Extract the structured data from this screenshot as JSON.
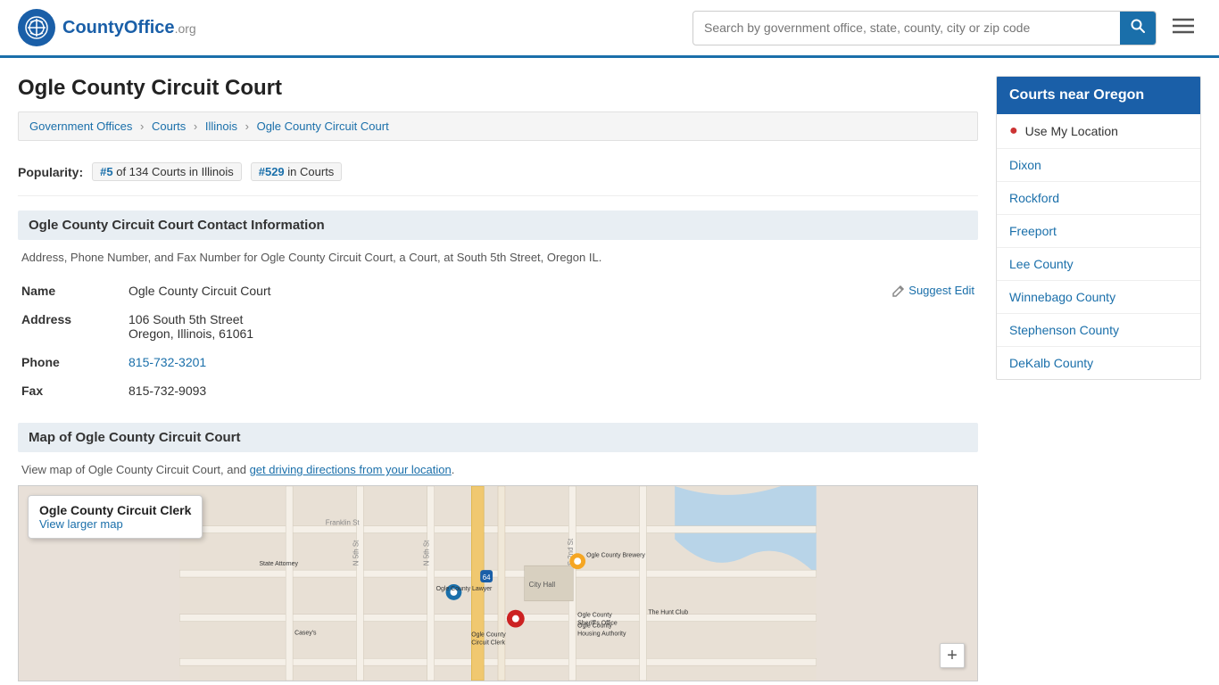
{
  "header": {
    "logo_text": "CountyOffice",
    "logo_org": ".org",
    "search_placeholder": "Search by government office, state, county, city or zip code",
    "search_value": ""
  },
  "page": {
    "title": "Ogle County Circuit Court",
    "breadcrumb": [
      {
        "label": "Government Offices",
        "href": "#"
      },
      {
        "label": "Courts",
        "href": "#"
      },
      {
        "label": "Illinois",
        "href": "#"
      },
      {
        "label": "Ogle County Circuit Court",
        "href": "#"
      }
    ],
    "popularity": {
      "label": "Popularity:",
      "rank1": "#5",
      "rank1_desc": "of 134 Courts in Illinois",
      "rank2": "#529",
      "rank2_desc": "in Courts"
    },
    "contact_section": {
      "title": "Ogle County Circuit Court Contact Information",
      "description": "Address, Phone Number, and Fax Number for Ogle County Circuit Court, a Court, at South 5th Street, Oregon IL.",
      "fields": [
        {
          "label": "Name",
          "value": "Ogle County Circuit Court",
          "type": "text"
        },
        {
          "label": "Address",
          "value": "106 South 5th Street",
          "value2": "Oregon, Illinois, 61061",
          "type": "address"
        },
        {
          "label": "Phone",
          "value": "815-732-3201",
          "type": "phone"
        },
        {
          "label": "Fax",
          "value": "815-732-9093",
          "type": "text"
        }
      ],
      "suggest_edit": "Suggest Edit"
    },
    "map_section": {
      "title": "Map of Ogle County Circuit Court",
      "description": "View map of Ogle County Circuit Court, and",
      "directions_link": "get driving directions from your location",
      "tooltip_title": "Ogle County Circuit Clerk",
      "tooltip_link": "View larger map"
    }
  },
  "sidebar": {
    "title": "Courts near Oregon",
    "use_location": "Use My Location",
    "items": [
      {
        "label": "Dixon"
      },
      {
        "label": "Rockford"
      },
      {
        "label": "Freeport"
      },
      {
        "label": "Lee County"
      },
      {
        "label": "Winnebago County"
      },
      {
        "label": "Stephenson County"
      },
      {
        "label": "DeKalb County"
      }
    ]
  }
}
